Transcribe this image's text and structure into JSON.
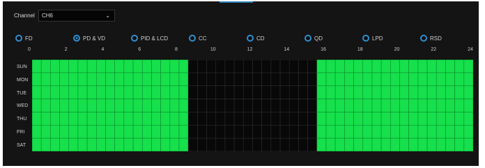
{
  "channel": {
    "label": "Channel",
    "value": "CH6",
    "chevron_icon": "chevron-down-icon"
  },
  "modes": [
    {
      "label": "FD",
      "selected": false
    },
    {
      "label": "PD & VD",
      "selected": true
    },
    {
      "label": "PID & LCD",
      "selected": false
    },
    {
      "label": "CC",
      "selected": false
    },
    {
      "label": "CD",
      "selected": false
    },
    {
      "label": "QD",
      "selected": false
    },
    {
      "label": "LPD",
      "selected": false
    },
    {
      "label": "RSD",
      "selected": false
    }
  ],
  "schedule": {
    "hour_labels": [
      "0",
      "2",
      "4",
      "6",
      "8",
      "10",
      "12",
      "14",
      "16",
      "18",
      "20",
      "22",
      "24"
    ],
    "days": [
      "SUN",
      "MON",
      "TUE",
      "WED",
      "THU",
      "FRI",
      "SAT"
    ],
    "ranges": [
      {
        "start": 0,
        "end": 8.5
      },
      {
        "start": 15.5,
        "end": 24
      }
    ],
    "active_color": "#16e04b",
    "inactive_color": "#080808",
    "grid_color_active": "#0d8a2f",
    "grid_color_inactive": "#2e2e2e"
  }
}
